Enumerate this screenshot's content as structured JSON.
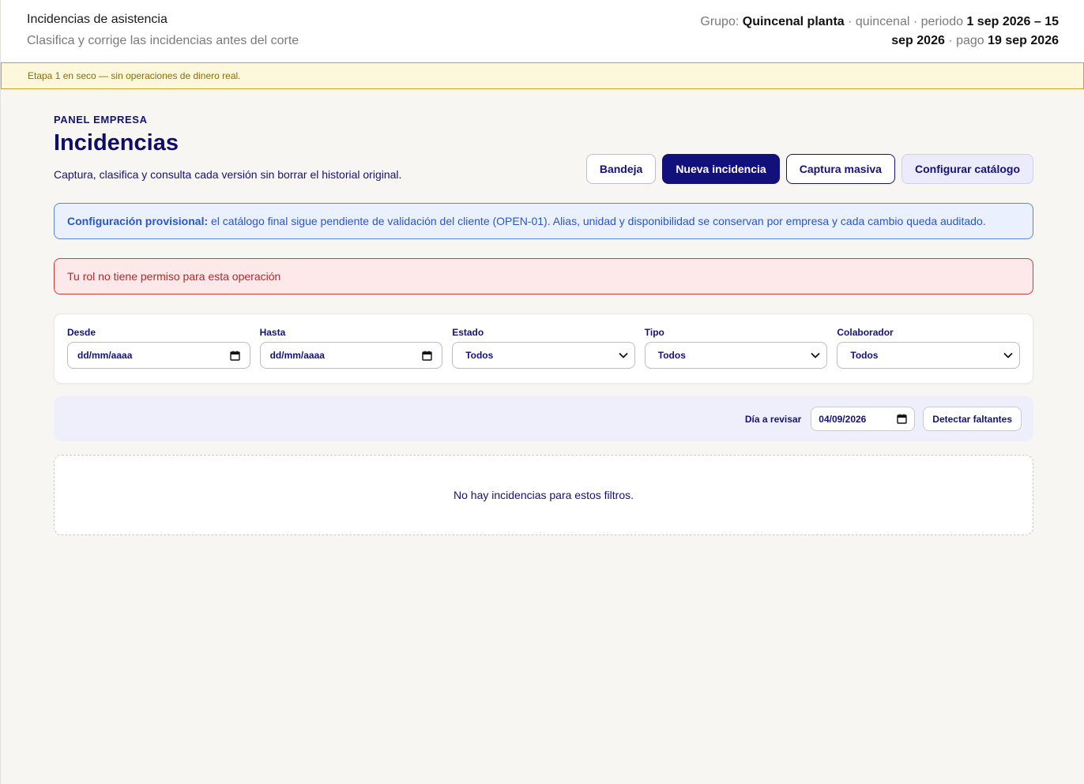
{
  "header": {
    "title": "Incidencias de asistencia",
    "subtitle": "Clasifica y corrige las incidencias antes del corte",
    "group_label": "Grupo:",
    "group_name": "Quincenal planta",
    "frequency": "· quincenal · periodo",
    "period_range": "1 sep 2026 – 15 sep 2026",
    "pay_label": "· pago",
    "pay_date": "19 sep 2026"
  },
  "banner": {
    "text": "Etapa 1 en seco — sin operaciones de dinero real."
  },
  "page": {
    "eyebrow": "PANEL EMPRESA",
    "title": "Incidencias",
    "description": "Captura, clasifica y consulta cada versión sin borrar el historial original."
  },
  "actions": {
    "inbox": "Bandeja",
    "new_incident": "Nueva incidencia",
    "bulk_capture": "Captura masiva",
    "configure_catalog": "Configurar catálogo"
  },
  "info": {
    "strong": "Configuración provisional:",
    "text": " el catálogo final sigue pendiente de validación del cliente (OPEN-01). Alias, unidad y disponibilidad se conservan por empresa y cada cambio queda auditado."
  },
  "error": {
    "text": "Tu rol no tiene permiso para esta operación"
  },
  "filters": {
    "from_label": "Desde",
    "from_placeholder": "dd/mm/aaaa",
    "to_label": "Hasta",
    "to_placeholder": "dd/mm/aaaa",
    "status_label": "Estado",
    "status_value": "Todos",
    "type_label": "Tipo",
    "type_value": "Todos",
    "employee_label": "Colaborador",
    "employee_value": "Todos"
  },
  "review": {
    "label": "Día a revisar",
    "date": "04/09/2026",
    "detect_button": "Detectar faltantes"
  },
  "empty": {
    "text": "No hay incidencias para estos filtros."
  },
  "icons": {
    "calendar": "calendar-icon",
    "chevron": "chevron-down-icon"
  },
  "colors": {
    "primary": "#12107a",
    "info_border": "#5a86d6",
    "error_border": "#d23b3b",
    "warning_border": "#c9a227"
  }
}
